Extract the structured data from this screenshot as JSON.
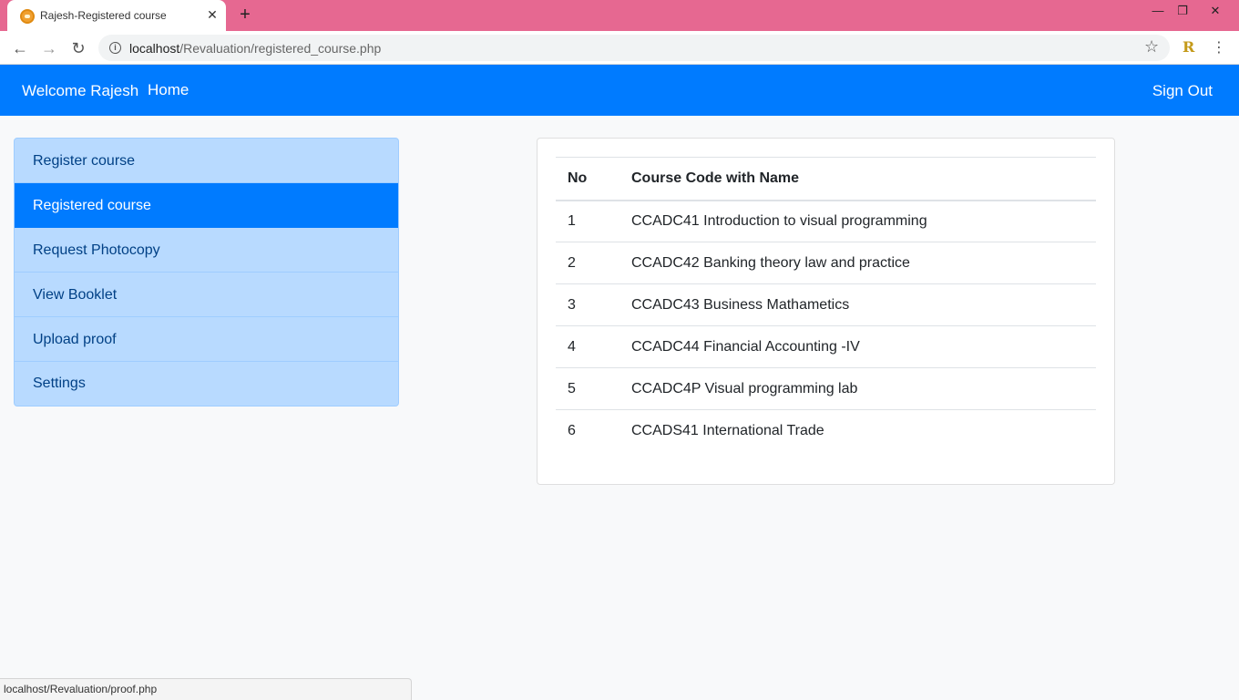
{
  "browser": {
    "tab_title": "Rajesh-Registered course",
    "url_host": "localhost",
    "url_path": "/Revaluation/registered_course.php",
    "extension_label": "R",
    "status_url": "localhost/Revaluation/proof.php"
  },
  "navbar": {
    "brand": "Welcome Rajesh",
    "home": "Home",
    "signout": "Sign Out"
  },
  "sidebar": {
    "items": [
      {
        "label": "Register course"
      },
      {
        "label": "Registered course"
      },
      {
        "label": "Request Photocopy"
      },
      {
        "label": "View Booklet"
      },
      {
        "label": "Upload proof"
      },
      {
        "label": "Settings"
      }
    ]
  },
  "table": {
    "headers": [
      "No",
      "Course Code with Name"
    ],
    "rows": [
      [
        "1",
        "CCADC41 Introduction to visual programming"
      ],
      [
        "2",
        "CCADC42 Banking theory law and practice"
      ],
      [
        "3",
        "CCADC43 Business Mathametics"
      ],
      [
        "4",
        "CCADC44 Financial Accounting -IV"
      ],
      [
        "5",
        "CCADC4P Visual programming lab"
      ],
      [
        "6",
        "CCADS41 International Trade"
      ]
    ]
  },
  "colors": {
    "primary": "#007bff",
    "sidebar_bg": "#b8daff",
    "sidebar_text": "#004085",
    "tabstrip": "#e66891"
  },
  "icons": {
    "favicon": "favicon-icon",
    "close": "close-icon",
    "new_tab": "plus-icon",
    "back": "back-arrow-icon",
    "forward": "forward-arrow-icon",
    "reload": "reload-icon",
    "info": "info-icon",
    "bookmark": "star-icon",
    "menu": "kebab-menu-icon"
  }
}
